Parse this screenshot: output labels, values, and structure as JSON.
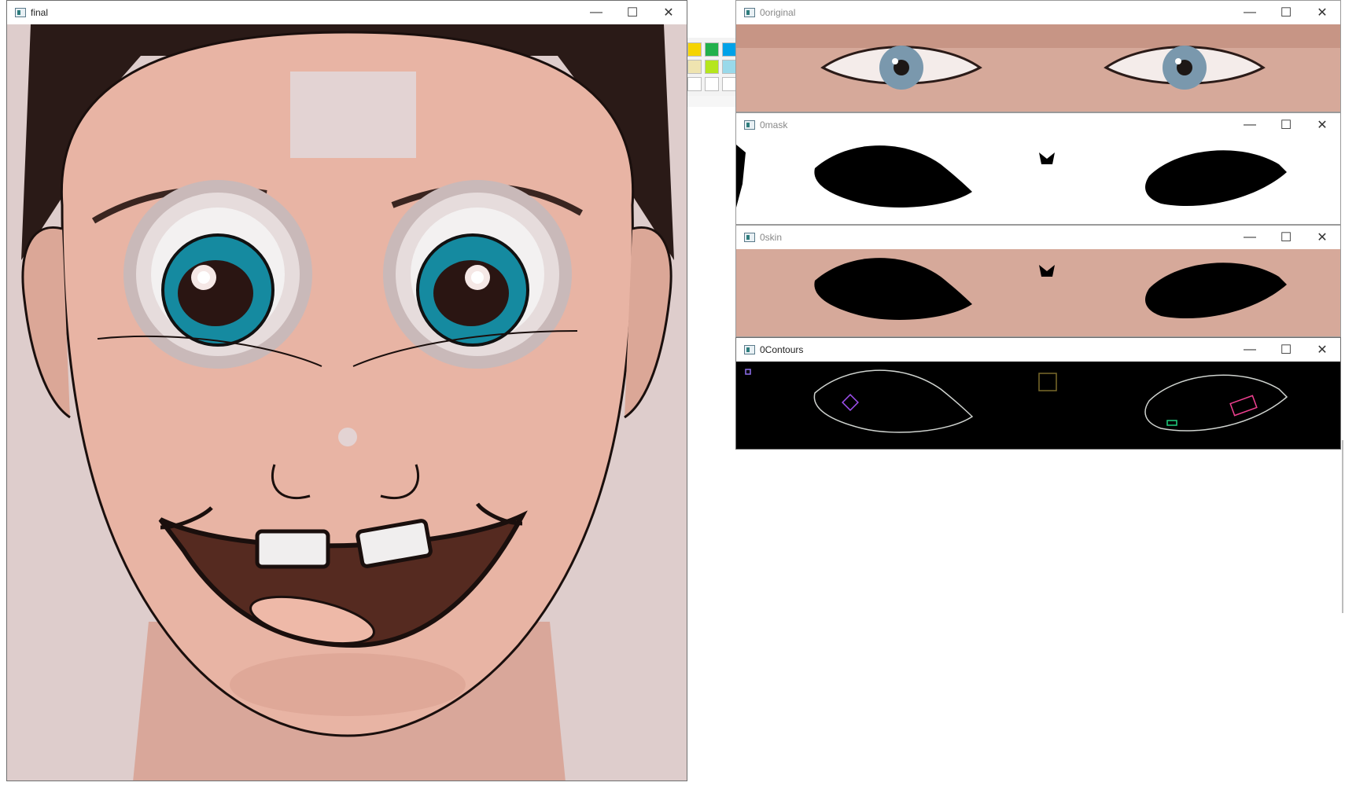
{
  "windows": {
    "final": {
      "title": "final"
    },
    "original": {
      "title": "0original"
    },
    "mask": {
      "title": "0mask"
    },
    "skin": {
      "title": "0skin"
    },
    "contours": {
      "title": "0Contours"
    }
  },
  "controls": {
    "minimize": "—",
    "maximize": "☐",
    "close": "✕"
  },
  "icons": {
    "window_icon": "app-window-icon",
    "minimize": "minimize-icon",
    "maximize": "maximize-icon",
    "close": "close-icon"
  },
  "palette_colors": [
    "#f5d400",
    "#22b14c",
    "#00a2e8",
    "#efe4b0",
    "#b5e61d",
    "#99d9ea",
    "#ffffff",
    "#ffffff",
    "#ffffff"
  ]
}
